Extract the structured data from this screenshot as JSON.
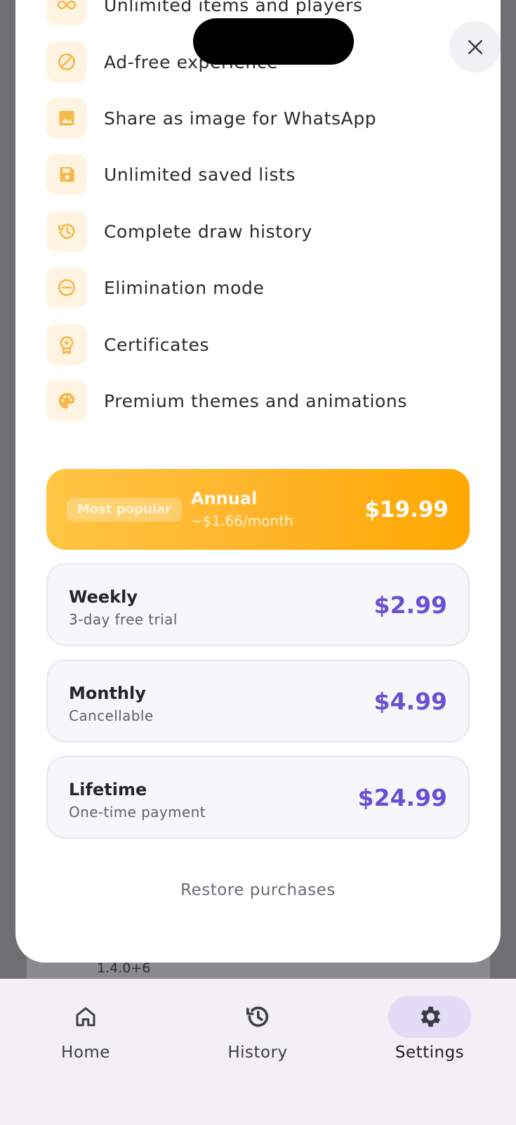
{
  "background": {
    "version": "1.4.0+6"
  },
  "sheet": {
    "features": [
      {
        "icon": "infinity-icon",
        "label": "Unlimited items and players"
      },
      {
        "icon": "ad-block-icon",
        "label": "Ad-free experience"
      },
      {
        "icon": "image-icon",
        "label": "Share as image for WhatsApp"
      },
      {
        "icon": "save-icon",
        "label": "Unlimited saved lists"
      },
      {
        "icon": "history-icon",
        "label": "Complete draw history"
      },
      {
        "icon": "minus-circle-icon",
        "label": "Elimination mode"
      },
      {
        "icon": "certificate-icon",
        "label": "Certificates"
      },
      {
        "icon": "palette-icon",
        "label": "Premium themes and animations"
      }
    ],
    "plans": {
      "annual": {
        "badge": "Most popular",
        "title": "Annual",
        "subtitle": "~$1.66/month",
        "price": "$19.99"
      },
      "weekly": {
        "title": "Weekly",
        "subtitle": "3-day free trial",
        "price": "$2.99"
      },
      "monthly": {
        "title": "Monthly",
        "subtitle": "Cancellable",
        "price": "$4.99"
      },
      "lifetime": {
        "title": "Lifetime",
        "subtitle": "One-time payment",
        "price": "$24.99"
      }
    },
    "restore_label": "Restore purchases"
  },
  "nav": {
    "items": [
      {
        "icon": "home-icon",
        "label": "Home"
      },
      {
        "icon": "history-icon",
        "label": "History"
      },
      {
        "icon": "gear-icon",
        "label": "Settings",
        "active": true
      }
    ]
  },
  "colors": {
    "accent": "#ffa800",
    "price": "#6a4fd4",
    "icon_tint": "#f7b84a",
    "icon_bg": "#fff4e2",
    "nav_active_bg": "#e3dcf6"
  }
}
